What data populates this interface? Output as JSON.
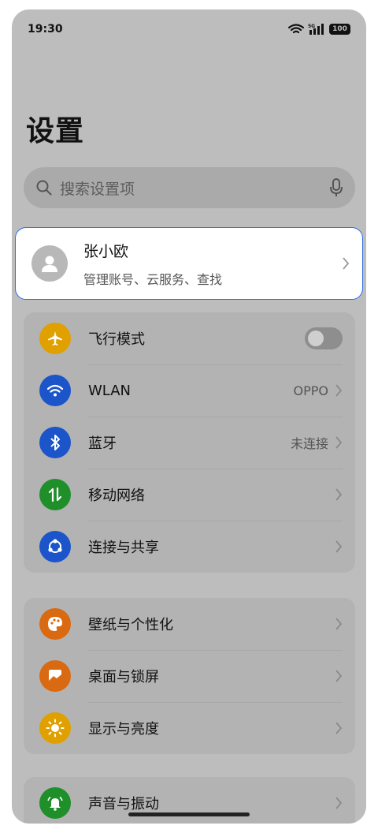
{
  "status_bar": {
    "time": "19:30",
    "network": "5G",
    "battery": "100"
  },
  "page_title": "设置",
  "search": {
    "placeholder": "搜索设置项"
  },
  "account": {
    "name": "张小欧",
    "subtitle": "管理账号、云服务、查找"
  },
  "connectivity": [
    {
      "label": "飞行模式",
      "icon": "airplane-icon",
      "color": "#e0a000",
      "toggle": "off"
    },
    {
      "label": "WLAN",
      "icon": "wifi-icon",
      "color": "#1b55c9",
      "value": "OPPO"
    },
    {
      "label": "蓝牙",
      "icon": "bluetooth-icon",
      "color": "#1b55c9",
      "value": "未连接"
    },
    {
      "label": "移动网络",
      "icon": "mobile-data-icon",
      "color": "#1f8f2a"
    },
    {
      "label": "连接与共享",
      "icon": "share-icon",
      "color": "#1b55c9"
    }
  ],
  "personalization": [
    {
      "label": "壁纸与个性化",
      "icon": "palette-icon",
      "color": "#d96a12"
    },
    {
      "label": "桌面与锁屏",
      "icon": "image-icon",
      "color": "#d96a12"
    },
    {
      "label": "显示与亮度",
      "icon": "sun-icon",
      "color": "#e0a000"
    }
  ],
  "sound": [
    {
      "label": "声音与振动",
      "icon": "bell-icon",
      "color": "#1f8f2a"
    }
  ]
}
